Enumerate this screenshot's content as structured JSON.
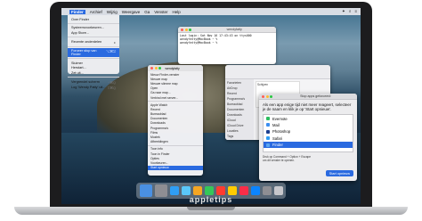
{
  "menubar": {
    "apple": "",
    "items": [
      "Finder",
      "Archief",
      "Wijzig",
      "Weergave",
      "Ga",
      "Venster",
      "Help"
    ],
    "active_index": 0,
    "right": [
      "✦",
      "⌕",
      "≡"
    ]
  },
  "finder_menu": {
    "items": [
      {
        "label": "Over Finder",
        "sc": ""
      },
      {
        "sep": true
      },
      {
        "label": "Systeemvoorkeuren...",
        "sc": ""
      },
      {
        "label": "App Store...",
        "sc": ""
      },
      {
        "sep": true
      },
      {
        "label": "Recente onderdelen",
        "sc": "▸"
      },
      {
        "sep": true
      },
      {
        "label": "Forceer stop van Finder",
        "sc": "⌥⌘⎋",
        "hl": true
      },
      {
        "sep": true
      },
      {
        "label": "Sluimer",
        "sc": ""
      },
      {
        "label": "Herstart...",
        "sc": ""
      },
      {
        "label": "Zet uit...",
        "sc": ""
      },
      {
        "sep": true
      },
      {
        "label": "Vergrendel scherm",
        "sc": "^⌘Q"
      },
      {
        "label": "Log 'Wendy Patty' uit...",
        "sc": "⇧⌘Q"
      }
    ]
  },
  "terminal": {
    "title": "wendyfatty",
    "lines": [
      "Last login: Sat Nov 16 17:43:43 on ttys000",
      "wendyfatty@MacBook ~ % ",
      "wendyfatty@MacBook ~ %"
    ]
  },
  "finder_back": {
    "sidebar": [
      "Favorieten",
      "AirDrop",
      "Recent",
      "Programma's",
      "Bureaublad",
      "Documenten",
      "Downloads",
      "iCloud",
      "iCloud Drive",
      "Locaties",
      "Tags"
    ],
    "pane_title": "Schijven"
  },
  "finder_front": {
    "title": "wendyfatty",
    "items": [
      "Nieuw Finder-venster",
      "Nieuwe map",
      "Nieuwe slimme map",
      "Open",
      "Ga naar map...",
      "Verbind met server...",
      "Apple Watch",
      "Recent",
      "Bureaublad",
      "Documenten",
      "Downloads",
      "Programma's",
      "Films",
      "Muziek",
      "Afbeeldingen",
      "Toon info",
      "Toon in Finder",
      "Opties",
      "Voorkeuren...",
      "Start opnieuw"
    ],
    "highlight_index": 19
  },
  "force_quit": {
    "title": "Stop apps geforceerd",
    "description": "Als een app enige tijd niet meer reageert, selecteer je de naam en klik je op 'Start opnieuw'.",
    "apps": [
      {
        "name": "Evernote",
        "icon_color": "#2dbe60"
      },
      {
        "name": "Mail",
        "icon_color": "#3a8ef0"
      },
      {
        "name": "Photoshop",
        "icon_color": "#1c3f8f"
      },
      {
        "name": "Safari",
        "icon_color": "#2f9ef4"
      },
      {
        "name": "Finder",
        "icon_color": "#5aa6f0",
        "selected": true
      }
    ],
    "footer": "Druk op Command + Option + Escape om dit venster te openen.",
    "button": "Start opnieuw"
  },
  "dock": {
    "icons": [
      {
        "name": "finder-icon",
        "color": "#4a90e2",
        "big": true
      },
      {
        "name": "launchpad-icon",
        "color": "#8e8e93",
        "big": true
      },
      {
        "name": "safari-icon",
        "color": "#2f9ef4"
      },
      {
        "name": "mail-icon",
        "color": "#5ac8fa"
      },
      {
        "name": "photos-icon",
        "color": "#f5a623"
      },
      {
        "name": "messages-icon",
        "color": "#34c759"
      },
      {
        "name": "calendar-icon",
        "color": "#ff3b30"
      },
      {
        "name": "notes-icon",
        "color": "#ffcc00"
      },
      {
        "name": "music-icon",
        "color": "#fa2d48"
      },
      {
        "name": "appstore-icon",
        "color": "#0a84ff"
      },
      {
        "name": "settings-icon",
        "color": "#8e8e93"
      },
      {
        "name": "trash-icon",
        "color": "#c7c7cc"
      }
    ]
  },
  "brand": "appletips"
}
